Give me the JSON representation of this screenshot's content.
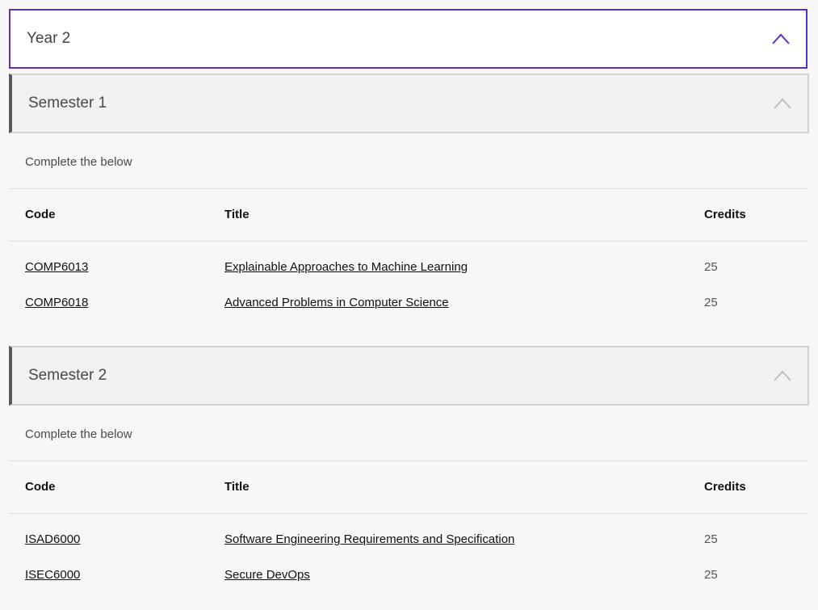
{
  "year": {
    "title": "Year 2",
    "accent": "#5b2ccf"
  },
  "semesters": [
    {
      "title": "Semester 1",
      "instruction": "Complete the below",
      "headers": {
        "code": "Code",
        "title": "Title",
        "credits": "Credits"
      },
      "rows": [
        {
          "code": "COMP6013",
          "title": "Explainable Approaches to Machine Learning",
          "credits": "25"
        },
        {
          "code": "COMP6018",
          "title": "Advanced Problems in Computer Science",
          "credits": "25"
        }
      ]
    },
    {
      "title": "Semester 2",
      "instruction": "Complete the below",
      "headers": {
        "code": "Code",
        "title": "Title",
        "credits": "Credits"
      },
      "rows": [
        {
          "code": "ISAD6000",
          "title": "Software Engineering Requirements and Specification",
          "credits": "25"
        },
        {
          "code": "ISEC6000",
          "title": "Secure DevOps",
          "credits": "25"
        }
      ]
    }
  ],
  "icons": {
    "collapse": "chevron-up-icon"
  }
}
